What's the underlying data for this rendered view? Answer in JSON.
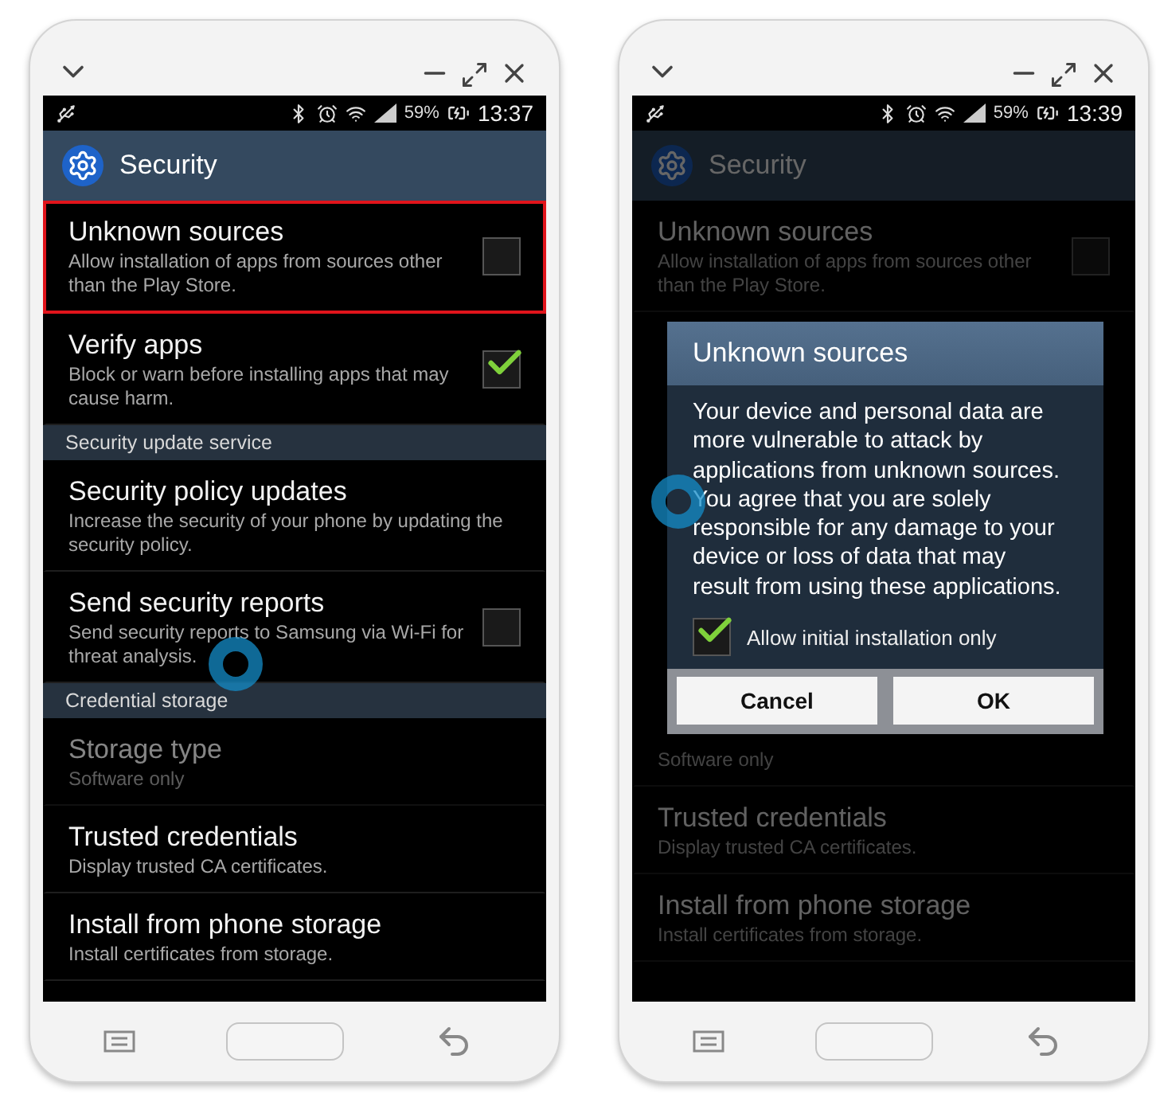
{
  "phones": [
    {
      "status": {
        "battery": "59%",
        "time": "13:37"
      },
      "title": "Security",
      "dimmed": false,
      "touch": true,
      "items": [
        {
          "kind": "toggle",
          "title": "Unknown sources",
          "subtitle": "Allow installation of apps from sources other than the Play Store.",
          "checked": false,
          "highlighted": true,
          "disabled": false
        },
        {
          "kind": "toggle",
          "title": "Verify apps",
          "subtitle": "Block or warn before installing apps that may cause harm.",
          "checked": true,
          "highlighted": false,
          "disabled": false
        },
        {
          "kind": "section",
          "label": "Security update service"
        },
        {
          "kind": "setting",
          "title": "Security policy updates",
          "subtitle": "Increase the security of your phone by updating the security policy.",
          "highlighted": false,
          "disabled": false
        },
        {
          "kind": "toggle",
          "title": "Send security reports",
          "subtitle": "Send security reports to Samsung via Wi-Fi for threat analysis.",
          "checked": false,
          "highlighted": false,
          "disabled": false
        },
        {
          "kind": "section",
          "label": "Credential storage"
        },
        {
          "kind": "setting",
          "title": "Storage type",
          "subtitle": "Software only",
          "highlighted": false,
          "disabled": true
        },
        {
          "kind": "setting",
          "title": "Trusted credentials",
          "subtitle": "Display trusted CA certificates.",
          "highlighted": false,
          "disabled": false
        },
        {
          "kind": "setting",
          "title": "Install from phone storage",
          "subtitle": "Install certificates from storage.",
          "highlighted": false,
          "disabled": false
        }
      ]
    },
    {
      "status": {
        "battery": "59%",
        "time": "13:39"
      },
      "title": "Security",
      "dimmed": true,
      "touch": true,
      "items": [
        {
          "kind": "toggle",
          "title": "Unknown sources",
          "subtitle": "Allow installation of apps from sources other than the Play Store.",
          "checked": false,
          "highlighted": false,
          "disabled": false
        },
        {
          "kind": "dialog",
          "title": "Unknown sources",
          "message": "Your device and personal data are more vulnerable to attack by applications from unknown sources. You agree that you are solely responsible for any damage to your device or loss of data that may result from using these applications.",
          "option": {
            "label": "Allow initial installation only",
            "checked": true
          },
          "buttons": [
            "Cancel",
            "OK"
          ]
        },
        {
          "kind": "setting",
          "subtitle": "Software only",
          "highlighted": false,
          "disabled": false
        },
        {
          "kind": "setting",
          "title": "Trusted credentials",
          "subtitle": "Display trusted CA certificates.",
          "highlighted": false,
          "disabled": false
        },
        {
          "kind": "setting",
          "title": "Install from phone storage",
          "subtitle": "Install certificates from storage.",
          "highlighted": false,
          "disabled": false
        }
      ]
    }
  ]
}
